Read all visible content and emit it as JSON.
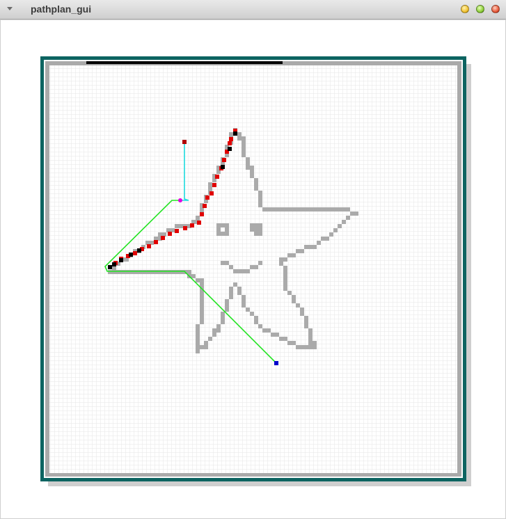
{
  "window": {
    "title": "pathplan_gui",
    "menu_icon": "chevron-down-icon",
    "buttons": [
      "minimize-icon",
      "maximize-icon",
      "close-icon"
    ]
  },
  "map": {
    "grid_color": "#e6e6e6",
    "frame_color": "#0d6461",
    "obstacle_color": "#aaaaaa",
    "explored_color": "#e00000",
    "path_color": "#000000",
    "goal_color": "#b00000",
    "start_color": "#0000cc",
    "smoothed_path_color": "#22e322",
    "heading_line_color": "#20dde0",
    "waypoint_color": "#e000e0",
    "progress_bar_color": "#000000"
  }
}
